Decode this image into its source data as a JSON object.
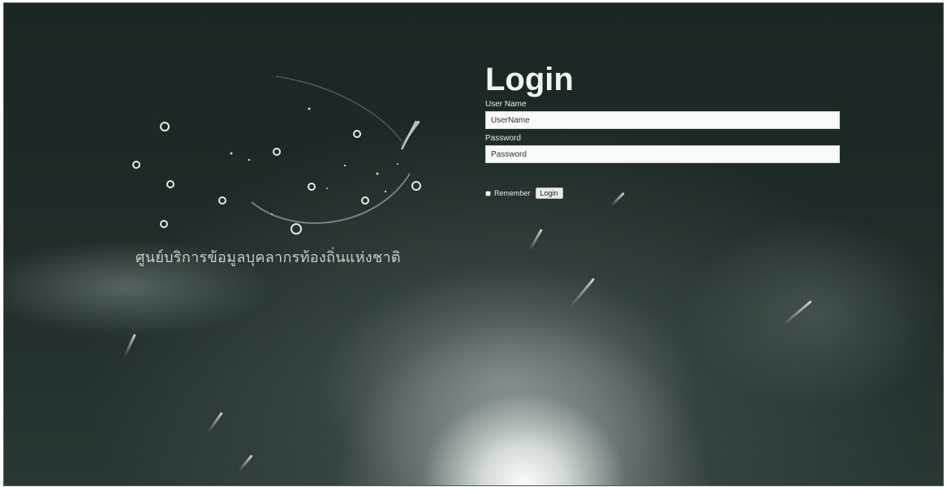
{
  "logo": {
    "org_name": "ศูนย์บริการข้อมูลบุคลากรท้องถิ่นแห่งชาติ",
    "icon": "network-globe-icon"
  },
  "login": {
    "title": "Login",
    "username_label": "User Name",
    "username_placeholder": "UserName",
    "password_label": "Password",
    "password_placeholder": "Password",
    "remember_label": "Remember",
    "remember_checked": false,
    "submit_label": "Login"
  },
  "colors": {
    "background": "#1d2a27",
    "text": "#f2f4f3",
    "input_bg": "#f8f9f9"
  }
}
